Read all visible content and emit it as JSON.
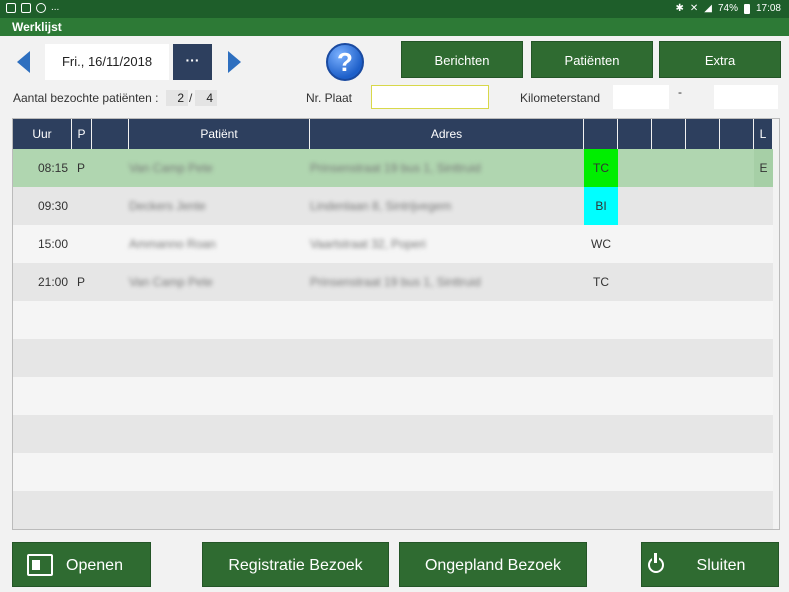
{
  "status_bar": {
    "battery": "74%",
    "time": "17:08",
    "extra": "..."
  },
  "window": {
    "title": "Werklijst"
  },
  "toolbar": {
    "date": "Fri., 16/11/2018",
    "more_label": "···",
    "help_label": "?",
    "berichten_label": "Berichten",
    "patienten_label": "Patiënten",
    "extra_label": "Extra"
  },
  "info": {
    "visited_label": "Aantal bezochte patiënten :",
    "visited_count": "2",
    "separator": "/",
    "total_count": "4",
    "plate_label": "Nr. Plaat",
    "plate_value": "",
    "km_label": "Kilometerstand",
    "km_dash": "-",
    "km_start": "",
    "km_end": ""
  },
  "table": {
    "headers": {
      "uur": "Uur",
      "p": "P",
      "patient": "Patiënt",
      "adres": "Adres",
      "l": "L"
    },
    "rows": [
      {
        "time": "08:15",
        "p": "P",
        "patient": "Van Camp Pete",
        "address": "Prinsenstraat 19 bus 1, Sinttruid",
        "code": "TC",
        "code_color": "#00ee00",
        "l": "E",
        "bg": "#b0d6b0"
      },
      {
        "time": "09:30",
        "p": "",
        "patient": "Deckers Jente",
        "address": "Lindenlaan 8, Sintrijvegem",
        "code": "BI",
        "code_color": "#00ffff",
        "l": "",
        "bg": "#e6e6e6"
      },
      {
        "time": "15:00",
        "p": "",
        "patient": "Ammanno Roan",
        "address": "Vaartstraat 32, Poperi",
        "code": "WC",
        "code_color": "",
        "l": "",
        "bg": "#f5f5f5"
      },
      {
        "time": "21:00",
        "p": "P",
        "patient": "Van Camp Pete",
        "address": "Prinsenstraat 19 bus 1, Sinttruid",
        "code": "TC",
        "code_color": "",
        "l": "",
        "bg": "#e6e6e6"
      }
    ]
  },
  "footer": {
    "openen": "Openen",
    "registratie": "Registratie Bezoek",
    "ongepland": "Ongepland Bezoek",
    "sluiten": "Sluiten"
  }
}
